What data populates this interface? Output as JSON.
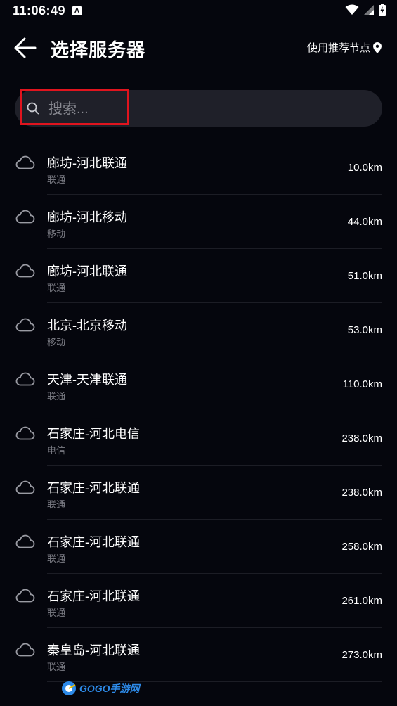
{
  "status_bar": {
    "time": "11:06:49",
    "notification_letter": "A"
  },
  "header": {
    "title": "选择服务器",
    "recommend_label": "使用推荐节点"
  },
  "search": {
    "placeholder": "搜索..."
  },
  "servers": [
    {
      "name": "廊坊-河北联通",
      "isp": "联通",
      "distance": "10.0km"
    },
    {
      "name": "廊坊-河北移动",
      "isp": "移动",
      "distance": "44.0km"
    },
    {
      "name": "廊坊-河北联通",
      "isp": "联通",
      "distance": "51.0km"
    },
    {
      "name": "北京-北京移动",
      "isp": "移动",
      "distance": "53.0km"
    },
    {
      "name": "天津-天津联通",
      "isp": "联通",
      "distance": "110.0km"
    },
    {
      "name": "石家庄-河北电信",
      "isp": "电信",
      "distance": "238.0km"
    },
    {
      "name": "石家庄-河北联通",
      "isp": "联通",
      "distance": "238.0km"
    },
    {
      "name": "石家庄-河北联通",
      "isp": "联通",
      "distance": "258.0km"
    },
    {
      "name": "石家庄-河北联通",
      "isp": "联通",
      "distance": "261.0km"
    },
    {
      "name": "秦皇岛-河北联通",
      "isp": "联通",
      "distance": "273.0km"
    }
  ],
  "watermark": {
    "text": "GOGO手游网"
  },
  "colors": {
    "background": "#05060d",
    "search_bg": "#1f2029",
    "highlight": "#e0141e",
    "secondary_text": "#7d7e86"
  },
  "icons": {
    "back": "arrow-left-icon",
    "location": "location-pin-icon",
    "search": "search-icon",
    "server": "cloud-icon"
  }
}
